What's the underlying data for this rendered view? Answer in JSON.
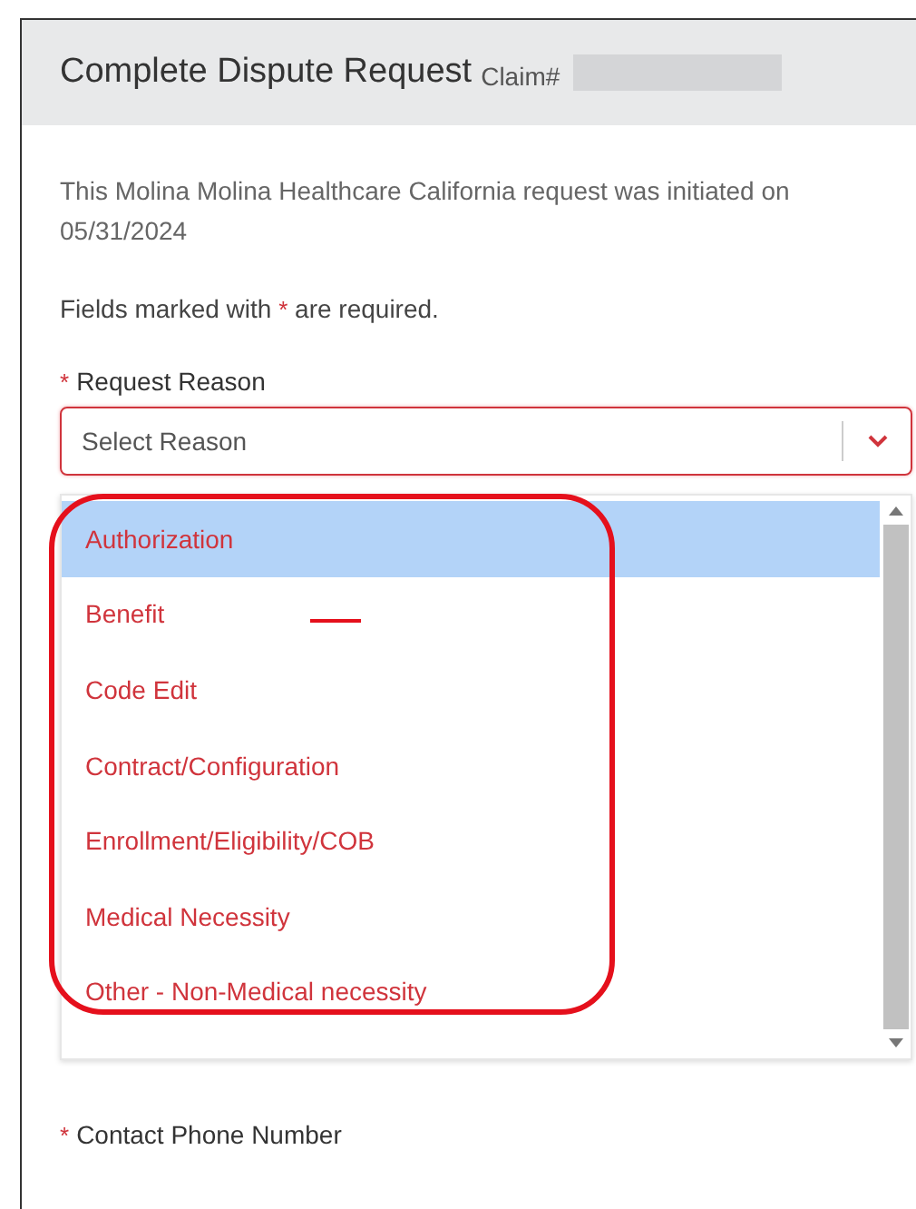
{
  "header": {
    "title": "Complete Dispute Request",
    "claim_label": "Claim#"
  },
  "intro": {
    "before": "This Molina Molina Healthcare California request was initiated on 05/31/2024"
  },
  "required_note": {
    "before": "Fields marked with",
    "mark": "*",
    "after": "are required."
  },
  "request_reason": {
    "required_mark": "*",
    "label": "Request Reason",
    "placeholder": "Select Reason",
    "expanded": true,
    "options": [
      {
        "label": "Authorization",
        "selected": true
      },
      {
        "label": "Benefit",
        "selected": false
      },
      {
        "label": "Code Edit",
        "selected": false
      },
      {
        "label": "Contract/Configuration",
        "selected": false
      },
      {
        "label": "Enrollment/Eligibility/COB",
        "selected": false
      },
      {
        "label": "Medical Necessity",
        "selected": false
      },
      {
        "label": "Other - Non-Medical necessity",
        "selected": false
      }
    ]
  },
  "contact_phone": {
    "required_mark": "*",
    "label": "Contact Phone Number"
  }
}
